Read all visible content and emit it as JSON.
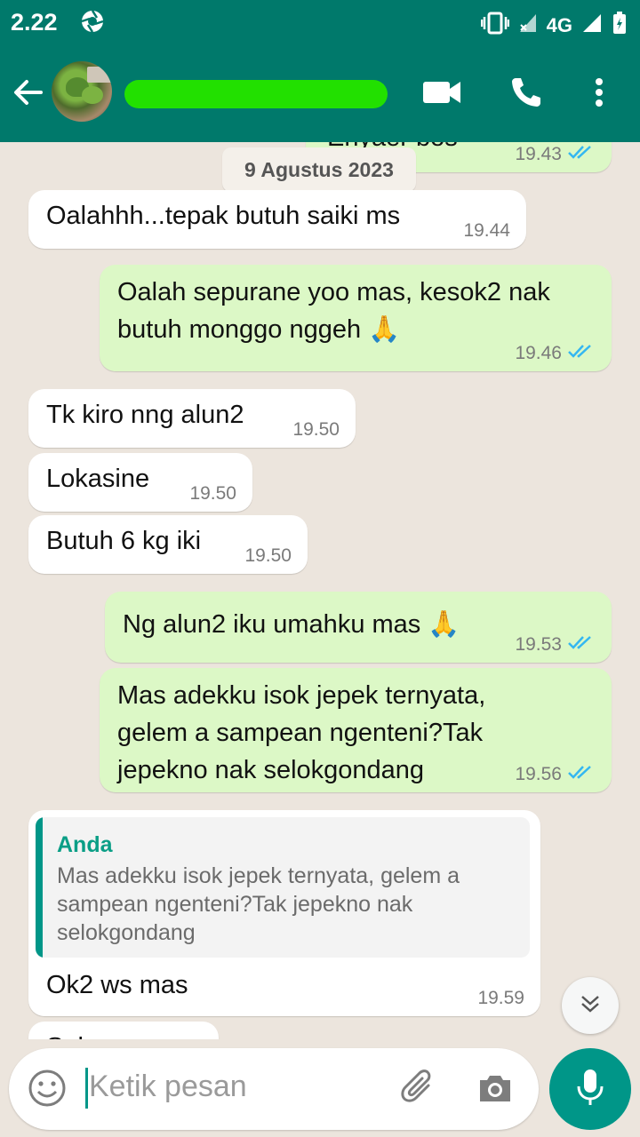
{
  "status_bar": {
    "time": "2.22",
    "network": "4G"
  },
  "header": {
    "contact_name": "",
    "icons": [
      "back-arrow-icon",
      "video-call-icon",
      "voice-call-icon",
      "more-vert-icon"
    ]
  },
  "chat": {
    "partial_top_message": {
      "text": "Enyaer bos",
      "time": "19.43",
      "ticks": "read"
    },
    "date_chip": "9 Agustus 2023",
    "messages": [
      {
        "dir": "in",
        "lines": [
          "Oalahhh...tepak butuh saiki ms"
        ],
        "time": "19.44"
      },
      {
        "dir": "out",
        "lines": [
          "Oalah sepurane yoo mas, kesok2 nak",
          "butuh monggo nggeh 🙏"
        ],
        "time": "19.46",
        "ticks": "read"
      },
      {
        "dir": "in",
        "lines": [
          "Tk kiro nng alun2"
        ],
        "time": "19.50"
      },
      {
        "dir": "in",
        "lines": [
          "Lokasine"
        ],
        "time": "19.50"
      },
      {
        "dir": "in",
        "lines": [
          "Butuh 6 kg iki"
        ],
        "time": "19.50"
      },
      {
        "dir": "out",
        "lines": [
          "Ng alun2 iku umahku mas 🙏"
        ],
        "time": "19.53",
        "ticks": "read"
      },
      {
        "dir": "out",
        "lines": [
          "Mas adekku isok jepek ternyata,",
          "gelem a sampean ngenteni?Tak",
          "jepekno nak selokgondang"
        ],
        "time": "19.56",
        "ticks": "read"
      }
    ],
    "reply_message": {
      "quote_author": "Anda",
      "quote_text": "Mas adekku isok jepek ternyata, gelem a sampean ngenteni?Tak jepekno nak selokgondang",
      "text": "Ok2 ws mas",
      "time": "19.59"
    },
    "partial_bottom_message": {
      "text": "Sak..."
    }
  },
  "composer": {
    "placeholder": "Ketik pesan"
  },
  "colors": {
    "header_bg": "#00796b",
    "outgoing_bubble": "#dcf8c6",
    "incoming_bubble": "#ffffff",
    "chat_bg": "#ece5dd",
    "accent": "#009688",
    "read_ticks": "#4fc3f7"
  }
}
